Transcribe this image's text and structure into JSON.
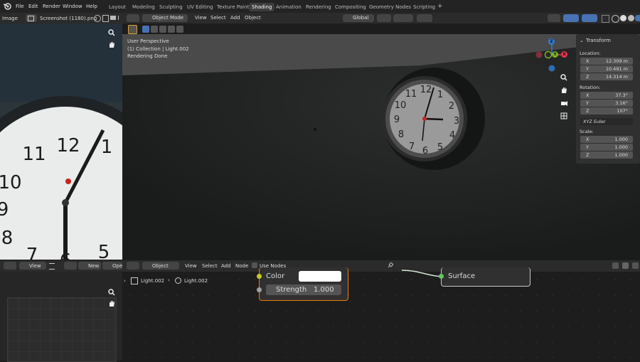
{
  "topbar": {
    "menus": [
      "File",
      "Edit",
      "Render",
      "Window",
      "Help"
    ],
    "workspaces": [
      "Layout",
      "Modeling",
      "Sculpting",
      "UV Editing",
      "Texture Paint",
      "Shading",
      "Animation",
      "Rendering",
      "Compositing",
      "Geometry Nodes",
      "Scripting"
    ],
    "active_workspace": "Shading",
    "add_tab": "+"
  },
  "image_editor": {
    "type_label": "Image",
    "filename": "Screenshot (1180).png"
  },
  "viewport": {
    "mode": "Object Mode",
    "menus": [
      "View",
      "Select",
      "Add",
      "Object"
    ],
    "orientation": "Global",
    "overlay_lines": [
      "User Perspective",
      "(1) Collection | Light.002",
      "Rendering Done"
    ],
    "gizmo": {
      "z": "Z",
      "y": "Y",
      "x": "X"
    }
  },
  "npanel": {
    "header": "Transform",
    "location_label": "Location:",
    "location": [
      {
        "k": "X",
        "v": "12.309 m"
      },
      {
        "k": "Y",
        "v": "10.491 m"
      },
      {
        "k": "Z",
        "v": "14.314 m"
      }
    ],
    "rotation_label": "Rotation:",
    "rotation": [
      {
        "k": "X",
        "v": "37.3°"
      },
      {
        "k": "Y",
        "v": "3.16°"
      },
      {
        "k": "Z",
        "v": "107°"
      }
    ],
    "rotation_mode": "XYZ Euler",
    "scale_label": "Scale:",
    "scale": [
      {
        "k": "X",
        "v": "1.000"
      },
      {
        "k": "Y",
        "v": "1.000"
      },
      {
        "k": "Z",
        "v": "1.000"
      }
    ]
  },
  "uv_editor": {
    "view": "View",
    "new_button": "New",
    "open_button": "Ope"
  },
  "node_editor": {
    "object_dropdown": "Object",
    "menus": [
      "View",
      "Select",
      "Add",
      "Node"
    ],
    "use_nodes": "Use Nodes",
    "breadcrumb_object": "Light.002",
    "breadcrumb_data": "Light.002",
    "color_label": "Color",
    "strength_label": "Strength",
    "strength_value": "1.000",
    "surface_label": "Surface"
  },
  "colors": {
    "accent": "#4772b3",
    "node_selected": "#e87d0d",
    "axis_x": "#e5374d",
    "axis_y": "#7bb32e",
    "axis_z": "#2d7ed9"
  }
}
